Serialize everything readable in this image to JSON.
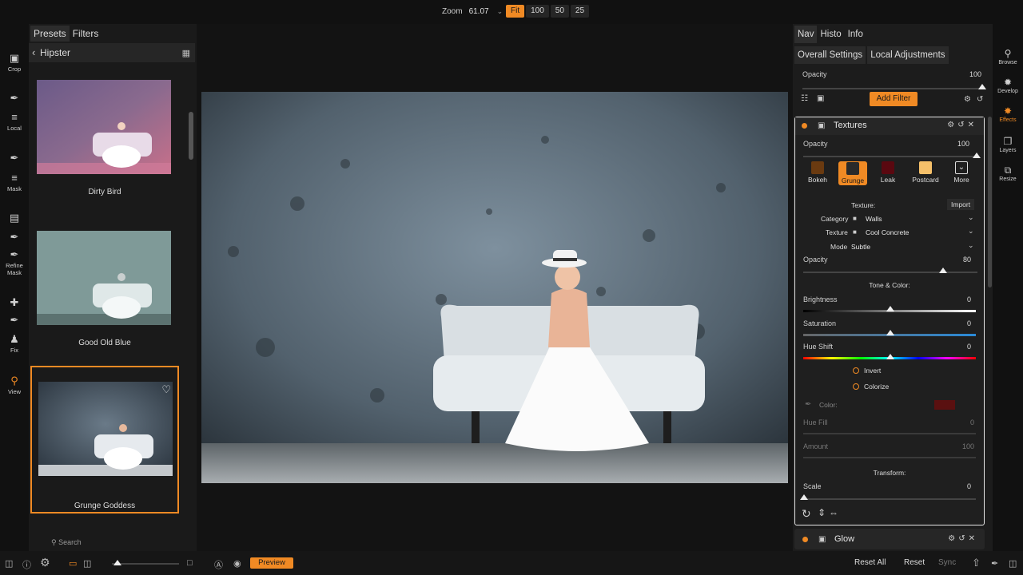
{
  "topbar": {
    "zoom_label": "Zoom",
    "zoom_value": "61.07",
    "zoom_buttons": [
      "Fit",
      "100",
      "50",
      "25"
    ]
  },
  "tools": [
    {
      "label": "Crop",
      "icon": "crop-icon"
    },
    {
      "label": "",
      "icon": "brush-icon"
    },
    {
      "label": "Local",
      "icon": "local-icon"
    },
    {
      "label": "",
      "icon": "mask-brush-icon"
    },
    {
      "label": "Mask",
      "icon": "mask-icon"
    },
    {
      "label": "",
      "icon": "refine-icon"
    },
    {
      "label": "Refine\nMask",
      "icon": "refine-mask-icon"
    },
    {
      "label": "Fix",
      "icon": "stamp-icon"
    },
    {
      "label": "View",
      "icon": "search-icon"
    }
  ],
  "left_panel": {
    "tabs": [
      "Presets",
      "Filters"
    ],
    "category": "Hipster",
    "presets": [
      {
        "name": "Dirty Bird"
      },
      {
        "name": "Good Old Blue"
      },
      {
        "name": "Grunge Goddess"
      }
    ],
    "search_placeholder": "Search"
  },
  "right_panel": {
    "tabs": [
      "Nav",
      "Histo",
      "Info"
    ],
    "subtabs": [
      "Overall Settings",
      "Local Adjustments"
    ],
    "opacity_label": "Opacity",
    "opacity_value": "100",
    "add_filter": "Add Filter",
    "textures": {
      "title": "Textures",
      "opacity_label": "Opacity",
      "opacity_value": "100",
      "types": [
        "Bokeh",
        "Grunge",
        "Leak",
        "Postcard",
        "More"
      ],
      "texture_label": "Texture:",
      "import_label": "Import",
      "category_label": "Category",
      "category_value": "Walls",
      "texture_name_label": "Texture",
      "texture_value": "Cool Concrete",
      "mode_label": "Mode",
      "mode_value": "Subtle",
      "opacity2_label": "Opacity",
      "opacity2_value": "80",
      "tone_color_label": "Tone & Color:",
      "brightness_label": "Brightness",
      "brightness_value": "0",
      "saturation_label": "Saturation",
      "saturation_value": "0",
      "hue_shift_label": "Hue Shift",
      "hue_shift_value": "0",
      "invert_label": "Invert",
      "colorize_label": "Colorize",
      "color_label": "Color:",
      "hue_fill_label": "Hue Fill",
      "hue_fill_value": "0",
      "amount_label": "Amount",
      "amount_value": "100",
      "transform_label": "Transform:",
      "scale_label": "Scale",
      "scale_value": "0"
    },
    "glow": {
      "title": "Glow"
    }
  },
  "modules": [
    "Browse",
    "Develop",
    "Effects",
    "Layers",
    "Resize"
  ],
  "bottombar": {
    "preview": "Preview",
    "reset_all": "Reset All",
    "reset": "Reset",
    "sync": "Sync"
  },
  "colors": {
    "accent": "#f08a24"
  }
}
